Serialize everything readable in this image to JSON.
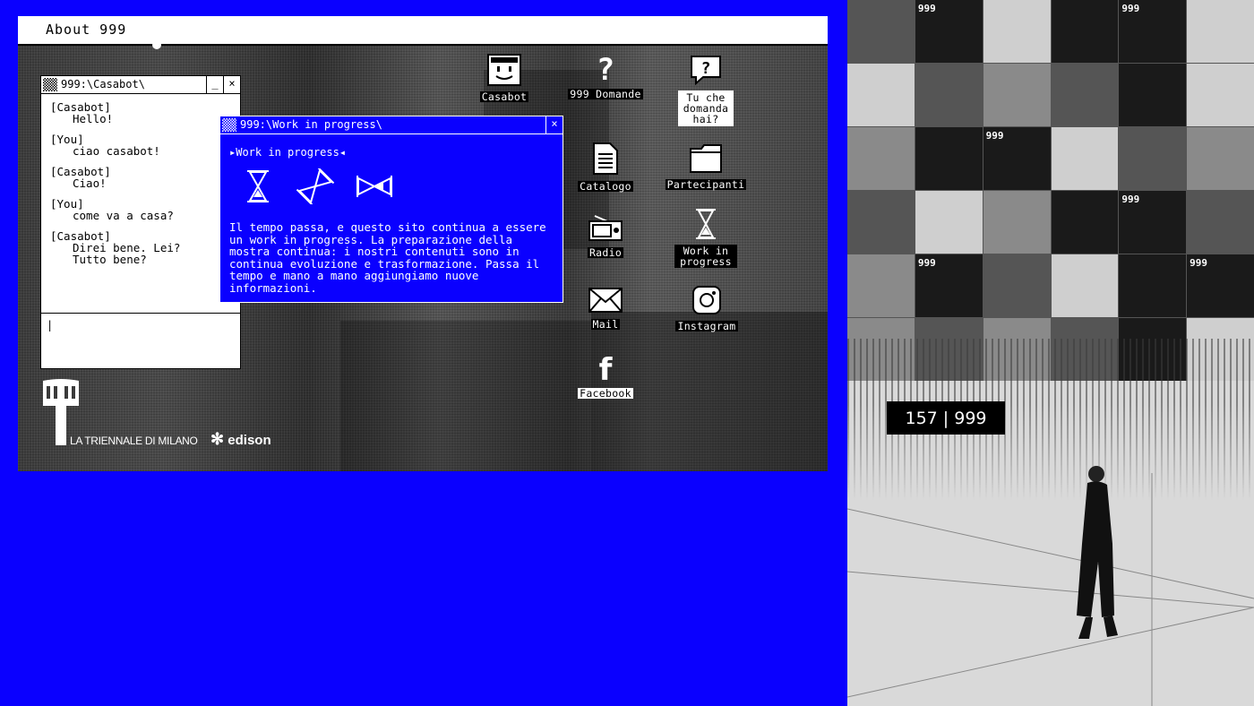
{
  "topbar": {
    "title": "About 999"
  },
  "casabot_window": {
    "title": "999:\\Casabot\\",
    "minimize": "_",
    "close": "×",
    "messages": [
      {
        "who": "[Casabot]",
        "text": "Hello!"
      },
      {
        "who": "[You]",
        "text": "ciao casabot!"
      },
      {
        "who": "[Casabot]",
        "text": "Ciao!"
      },
      {
        "who": "[You]",
        "text": "come va a casa?"
      },
      {
        "who": "[Casabot]",
        "text": "Direi bene. Lei?\nTutto bene?"
      }
    ],
    "input_value": "|"
  },
  "wip_window": {
    "title": "999:\\Work in progress\\",
    "close": "×",
    "heading": "▸Work in progress◂",
    "body": "Il tempo passa, e questo sito continua a essere un work in progress. La preparazione della mostra continua: i nostri contenuti sono in continua evoluzione e trasformazione. Passa il tempo e mano a mano aggiungiamo nuove informazioni."
  },
  "desktop_icons": {
    "casabot": "Casabot",
    "domande": "999 Domande",
    "tu_che": "Tu che\ndomanda\nhai?",
    "catalogo": "Catalogo",
    "partecipanti": "Partecipanti",
    "radio": "Radio",
    "work": "Work in\nprogress",
    "mail": "Mail",
    "instagram": "Instagram",
    "facebook": "Facebook"
  },
  "logos": {
    "triennale": "LA TRIENNALE DI MILANO",
    "edison": "edison"
  },
  "right_panel": {
    "counter": "157 | 999",
    "tile_titles": [
      "999",
      "999",
      "999",
      "999",
      "999",
      "999"
    ]
  },
  "colors": {
    "background": "#0a00ff",
    "window_blue": "#0a00ff"
  }
}
